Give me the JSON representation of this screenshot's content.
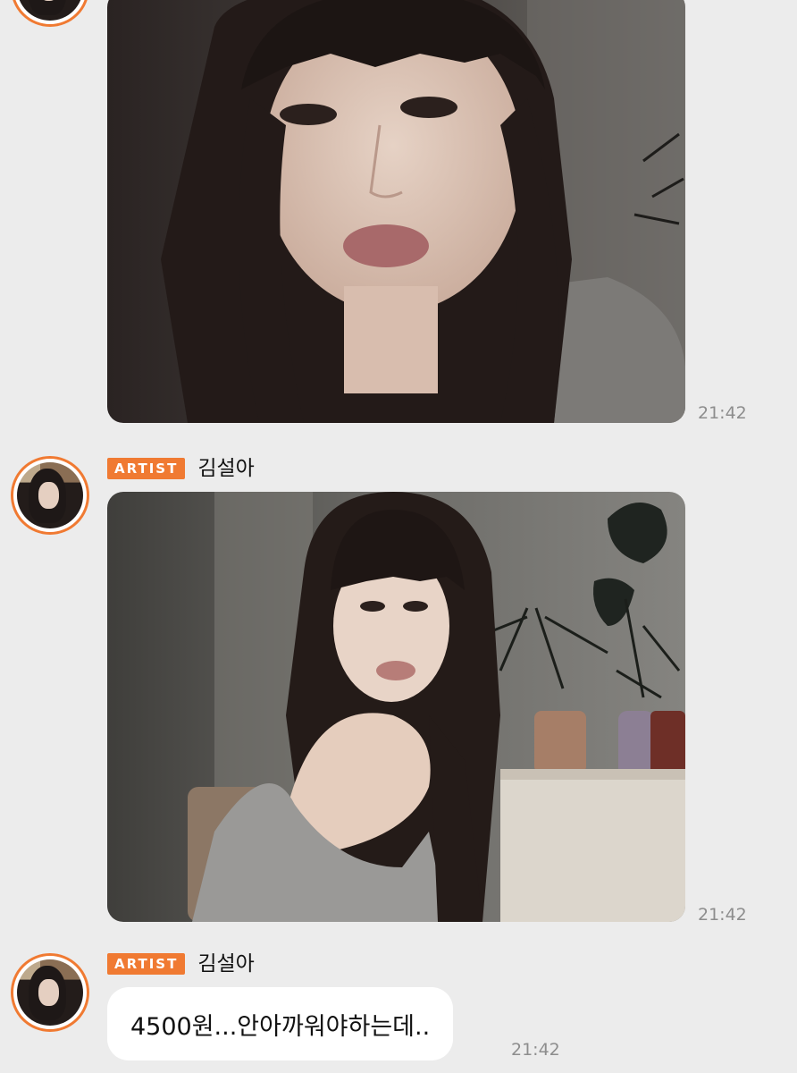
{
  "messages": [
    {
      "type": "photo",
      "time": "21:42"
    },
    {
      "type": "photo",
      "badge": "ARTIST",
      "sender": "김설아",
      "time": "21:42"
    },
    {
      "type": "text",
      "badge": "ARTIST",
      "sender": "김설아",
      "text": "4500원...안아까워야하는데..",
      "time": "21:42"
    }
  ],
  "colors": {
    "background": "#ececec",
    "accent": "#f07a32",
    "bubble": "#ffffff",
    "time": "#8d8d8d"
  }
}
